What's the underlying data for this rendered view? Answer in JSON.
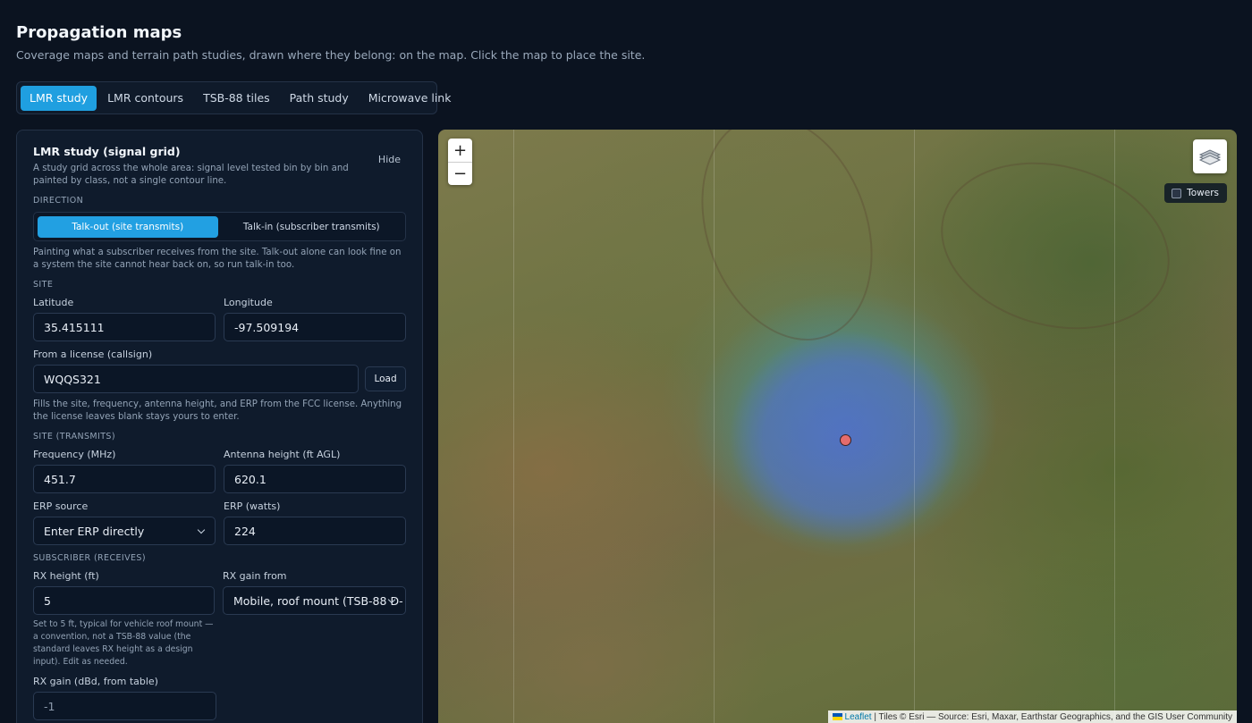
{
  "page": {
    "title": "Propagation maps",
    "subtitle": "Coverage maps and terrain path studies, drawn where they belong: on the map. Click the map to place the site."
  },
  "tabs": [
    "LMR study",
    "LMR contours",
    "TSB-88 tiles",
    "Path study",
    "Microwave link"
  ],
  "active_tab": "LMR study",
  "panel": {
    "title": "LMR study (signal grid)",
    "description": "A study grid across the whole area: signal level tested bin by bin and painted by class, not a single contour line.",
    "hide_label": "Hide",
    "direction": {
      "label": "DIRECTION",
      "options": [
        "Talk-out (site transmits)",
        "Talk-in (subscriber transmits)"
      ],
      "selected": "Talk-out (site transmits)",
      "hint": "Painting what a subscriber receives from the site. Talk-out alone can look fine on a system the site cannot hear back on, so run talk-in too."
    },
    "site": {
      "label": "SITE",
      "latitude_label": "Latitude",
      "latitude": "35.415111",
      "longitude_label": "Longitude",
      "longitude": "-97.509194",
      "license_label": "From a license (callsign)",
      "callsign": "WQQS321",
      "load_label": "Load",
      "license_hint": "Fills the site, frequency, antenna height, and ERP from the FCC license. Anything the license leaves blank stays yours to enter."
    },
    "transmit": {
      "label": "SITE (TRANSMITS)",
      "frequency_label": "Frequency (MHz)",
      "frequency": "451.7",
      "antenna_height_label": "Antenna height (ft AGL)",
      "antenna_height": "620.1",
      "erp_source_label": "ERP source",
      "erp_source": "Enter ERP directly",
      "erp_label": "ERP (watts)",
      "erp": "224"
    },
    "subscriber": {
      "label": "SUBSCRIBER (RECEIVES)",
      "rx_height_label": "RX height (ft)",
      "rx_height": "5",
      "rx_height_hint": "Set to 5 ft, typical for vehicle roof mount — a convention, not a TSB-88 value (the standard leaves RX height as a design input). Edit as needed.",
      "rx_gain_from_label": "RX gain from",
      "rx_gain_from": "Mobile, roof mount (TSB-88 D-",
      "rx_gain_label": "RX gain (dBd, from table)",
      "rx_gain": "-1"
    }
  },
  "map": {
    "zoom_in": "+",
    "zoom_out": "−",
    "layers_icon": "layers-icon",
    "towers_label": "Towers",
    "towers_checked": false,
    "attribution_link": "Leaflet",
    "attribution_text": " | Tiles © Esri — Source: Esri, Maxar, Earthstar Geographics, and the GIS User Community"
  }
}
